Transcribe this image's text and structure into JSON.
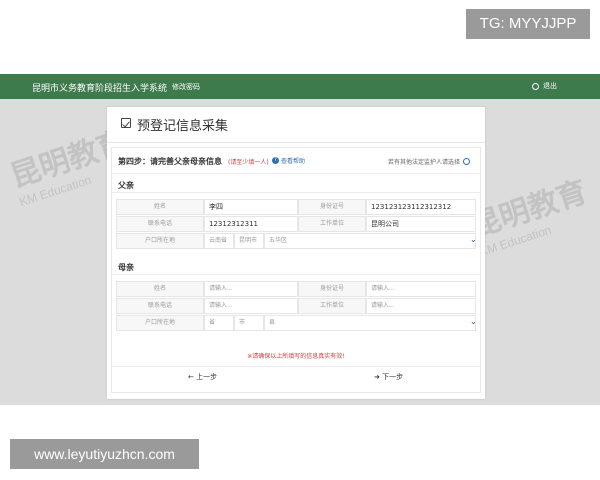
{
  "overlay": {
    "tg_tag": "TG: MYYJJPP",
    "url_tag": "www.leyutiyuzhcn.com"
  },
  "topbar": {
    "system_name": "昆明市义务教育阶段招生入学系统",
    "change_password": "修改密码",
    "exit": "退出"
  },
  "watermark": {
    "text": "昆明教育",
    "subtext": "KM Education"
  },
  "panel": {
    "title": "预登记信息采集",
    "step_label": "第四步：请完善父亲母亲信息",
    "step_required": "(请至少填一人)",
    "help_link": "查看帮助",
    "other_guardian": "若有其他法定监护人请选择"
  },
  "father": {
    "section_title": "父亲",
    "name_label": "姓名",
    "name_value": "李四",
    "id_label": "身份证号",
    "id_value": "123123123112312312",
    "phone_label": "联系电话",
    "phone_value": "12312312311",
    "work_label": "工作单位",
    "work_value": "昆明公司",
    "hukou_label": "户口所在地",
    "hukou_province": "云南省",
    "hukou_city": "昆明市",
    "hukou_district": "五华区"
  },
  "mother": {
    "section_title": "母亲",
    "name_label": "姓名",
    "name_placeholder": "请输入...",
    "id_label": "身份证号",
    "id_placeholder": "请输入...",
    "phone_label": "联系电话",
    "phone_placeholder": "请输入...",
    "work_label": "工作单位",
    "work_placeholder": "请输入...",
    "hukou_label": "户口所在地",
    "hukou_province": "省",
    "hukou_city": "市",
    "hukou_district": "县"
  },
  "footer": {
    "warning": "※请确保以上所填写的信息真实有效!",
    "prev": "上一步",
    "next": "下一步"
  },
  "colors": {
    "topbar": "#3d7a4c",
    "accent": "#2f6fb1",
    "warning": "#d23c3c"
  }
}
